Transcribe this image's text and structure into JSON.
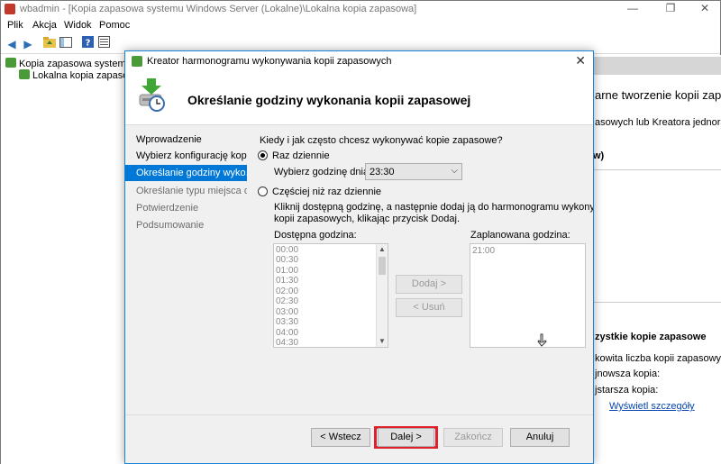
{
  "main_window": {
    "title": "wbadmin - [Kopia zapasowa systemu Windows Server (Lokalne)\\Lokalna kopia zapasowa]",
    "controls": {
      "minimize": "—",
      "restore": "❐",
      "close": "✕"
    },
    "menu": [
      "Plik",
      "Akcja",
      "Widok",
      "Pomoc"
    ],
    "toolbar_icons": [
      "back-arrow-icon",
      "forward-arrow-icon",
      "folder-up-icon",
      "show-tree-icon",
      "help-icon",
      "properties-icon"
    ]
  },
  "tree": {
    "root": "Kopia zapasowa systemu W",
    "child": "Lokalna kopia zapasow"
  },
  "right_panel": {
    "heading_fragment": "arne tworzenie kopii zapasowych",
    "line1": "asowych lub Kreatora jednora",
    "line2": "w)",
    "section": "zystkie kopie zapasowe",
    "items": [
      "kowita liczba kopii zapasowych:",
      "jnowsza kopia:",
      "jstarsza kopia:"
    ],
    "link": "Wyświetl szczegóły"
  },
  "dialog": {
    "title": "Kreator harmonogramu wykonywania kopii zapasowych",
    "close": "✕",
    "heading": "Określanie godziny wykonania kopii zapasowej",
    "steps": [
      {
        "label": "Wprowadzenie",
        "state": "done"
      },
      {
        "label": "Wybierz konfigurację kop...",
        "state": "done"
      },
      {
        "label": "Określanie godziny wyko...",
        "state": "active"
      },
      {
        "label": "Określanie typu miejsca d...",
        "state": "disabled"
      },
      {
        "label": "Potwierdzenie",
        "state": "disabled"
      },
      {
        "label": "Podsumowanie",
        "state": "disabled"
      }
    ],
    "question": "Kiedy i jak często chcesz wykonywać kopie zapasowe?",
    "option_once": "Raz dziennie",
    "time_label": "Wybierz godzinę dnia:",
    "time_value": "23:30",
    "option_multi": "Częściej niż raz dziennie",
    "multi_desc_line1": "Kliknij dostępną godzinę, a następnie dodaj ją do harmonogramu wykonywania",
    "multi_desc_line2": "kopii zapasowych, klikając przycisk Dodaj.",
    "available_label": "Dostępna godzina:",
    "available_times": [
      "00:00",
      "00:30",
      "01:00",
      "01:30",
      "02:00",
      "02:30",
      "03:00",
      "03:30",
      "04:00",
      "04:30"
    ],
    "scheduled_label": "Zaplanowana godzina:",
    "scheduled_times": [
      "21:00"
    ],
    "add_button": "Dodaj >",
    "remove_button": "< Usuń",
    "back_button": "< Wstecz",
    "next_button": "Dalej >",
    "finish_button": "Zakończ",
    "cancel_button": "Anuluj"
  }
}
